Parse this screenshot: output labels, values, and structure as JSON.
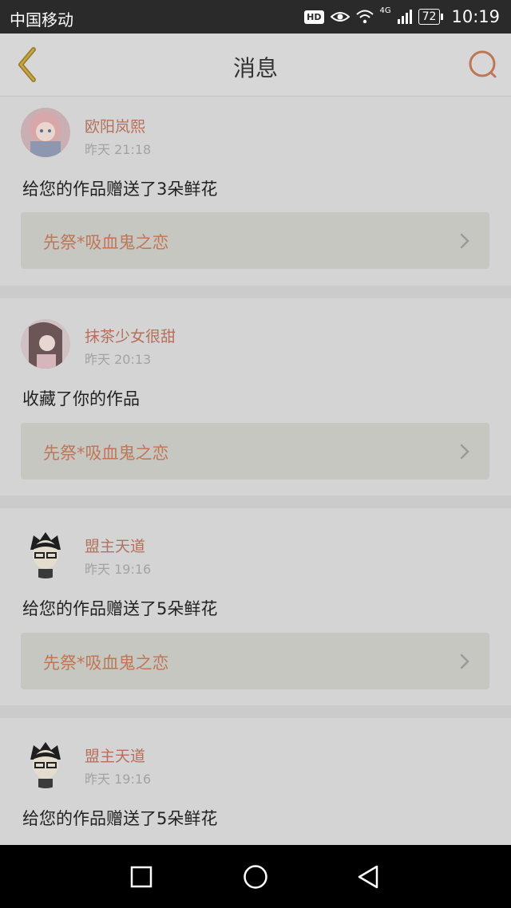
{
  "status_bar": {
    "carrier": "中国移动",
    "hd": "HD",
    "network": "4G",
    "battery": "72",
    "time": "10:19"
  },
  "header": {
    "title": "消息",
    "back_icon": "chevron-left-icon",
    "search_icon": "search-icon"
  },
  "colors": {
    "accent": "#b5705b",
    "link_text": "#c07656",
    "back_icon": "#9a7d2e"
  },
  "messages": [
    {
      "user": "欧阳岚熙",
      "time": "昨天 21:18",
      "text": "给您的作品赠送了3朵鲜花",
      "work": "先祭*吸血鬼之恋"
    },
    {
      "user": "抹茶少女很甜",
      "time": "昨天 20:13",
      "text": "收藏了你的作品",
      "work": "先祭*吸血鬼之恋"
    },
    {
      "user": "盟主天道",
      "time": "昨天 19:16",
      "text": "给您的作品赠送了5朵鲜花",
      "work": "先祭*吸血鬼之恋"
    },
    {
      "user": "盟主天道",
      "time": "昨天 19:16",
      "text": "给您的作品赠送了5朵鲜花"
    }
  ]
}
